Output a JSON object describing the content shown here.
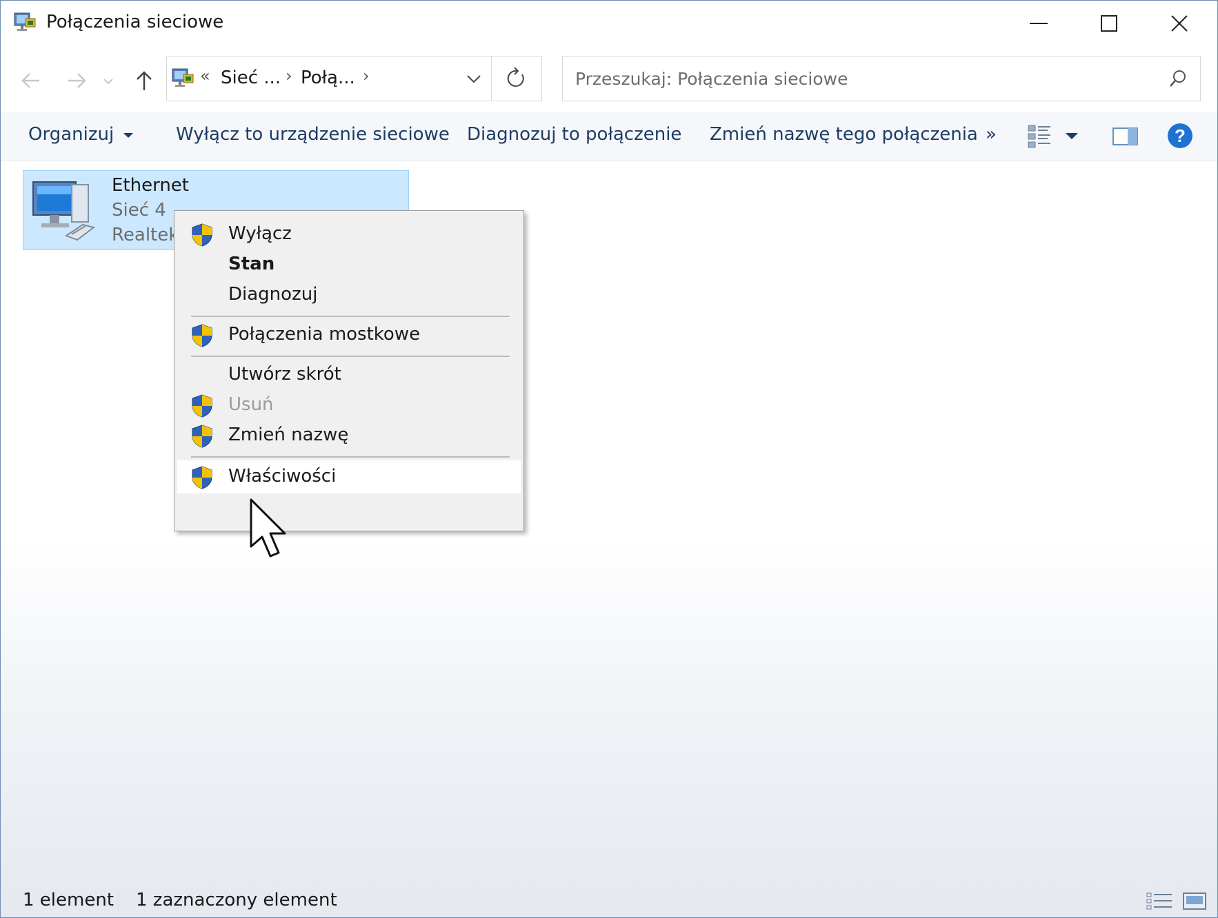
{
  "window": {
    "title": "Połączenia sieciowe",
    "icon": "network-connections-icon"
  },
  "nav": {
    "back_icon": "arrow-left-icon",
    "forward_icon": "arrow-right-icon",
    "recent_icon": "chevron-down-icon",
    "up_icon": "arrow-up-icon",
    "breadcrumb_overflow": "«",
    "breadcrumbs": [
      "Sieć ...",
      "Połą..."
    ],
    "refresh_icon": "refresh-icon",
    "search_placeholder": "Przeszukaj: Połączenia sieciowe"
  },
  "commands": {
    "organize": "Organizuj",
    "disable_device": "Wyłącz to urządzenie sieciowe",
    "diagnose": "Diagnozuj to połączenie",
    "rename": "Zmień nazwę tego połączenia",
    "more": "»"
  },
  "item": {
    "name": "Ethernet",
    "network": "Sieć 4",
    "adapter": "Realtek"
  },
  "context_menu": {
    "items": [
      {
        "label": "Wyłącz",
        "shield": true,
        "bold": false,
        "disabled": false
      },
      {
        "label": "Stan",
        "shield": false,
        "bold": true,
        "disabled": false
      },
      {
        "label": "Diagnozuj",
        "shield": false,
        "bold": false,
        "disabled": false
      },
      {
        "label": "Połączenia mostkowe",
        "shield": true,
        "bold": false,
        "disabled": false
      },
      {
        "label": "Utwórz skrót",
        "shield": false,
        "bold": false,
        "disabled": false
      },
      {
        "label": "Usuń",
        "shield": true,
        "bold": false,
        "disabled": true
      },
      {
        "label": "Zmień nazwę",
        "shield": true,
        "bold": false,
        "disabled": false
      },
      {
        "label": "Właściwości",
        "shield": true,
        "bold": false,
        "disabled": false,
        "highlighted": true
      }
    ]
  },
  "status": {
    "count": "1 element",
    "selected": "1 zaznaczony element"
  },
  "colors": {
    "selection_bg": "#cce8ff",
    "selection_border": "#99d1ff",
    "command_text": "#1e3c64",
    "help_blue": "#1e73d2",
    "shield_blue": "#2f62b8",
    "shield_yellow": "#f3c200"
  }
}
